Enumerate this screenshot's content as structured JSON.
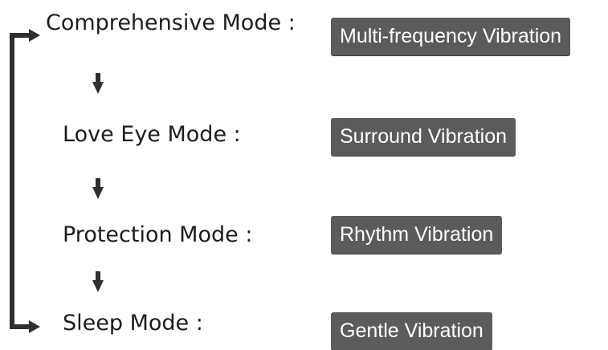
{
  "modes": [
    {
      "label": "Comprehensive Mode :",
      "vibration": "Multi-frequency Vibration"
    },
    {
      "label": "Love Eye Mode :",
      "vibration": "Surround Vibration"
    },
    {
      "label": "Protection Mode :",
      "vibration": "Rhythm Vibration"
    },
    {
      "label": "Sleep Mode :",
      "vibration": "Gentle Vibration"
    }
  ],
  "colors": {
    "text": "#1c1c1c",
    "badge_background": "#5b5b5b",
    "badge_text": "#ffffff",
    "arrow": "#2f2f2f"
  },
  "icons": {
    "step_arrow": "arrow-down-icon",
    "loop_arrow": "loop-back-arrow-icon"
  }
}
